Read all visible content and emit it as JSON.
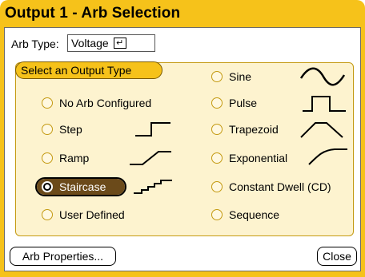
{
  "title": "Output 1 - Arb Selection",
  "arb_type": {
    "label": "Arb Type:",
    "value": "Voltage",
    "enter_glyph": "↵"
  },
  "group_title": "Select an Output Type",
  "options": {
    "no_arb": "No Arb Configured",
    "step": "Step",
    "ramp": "Ramp",
    "staircase": "Staircase",
    "user_defined": "User Defined",
    "sine": "Sine",
    "pulse": "Pulse",
    "trapezoid": "Trapezoid",
    "exponential": "Exponential",
    "constant_dwell": "Constant Dwell (CD)",
    "sequence": "Sequence"
  },
  "selected": "staircase",
  "buttons": {
    "arb_properties": "Arb Properties...",
    "close": "Close"
  },
  "colors": {
    "window": "#f6c21a",
    "group_bg": "#fdf3cf",
    "selected_bg": "#6b4a1a"
  }
}
